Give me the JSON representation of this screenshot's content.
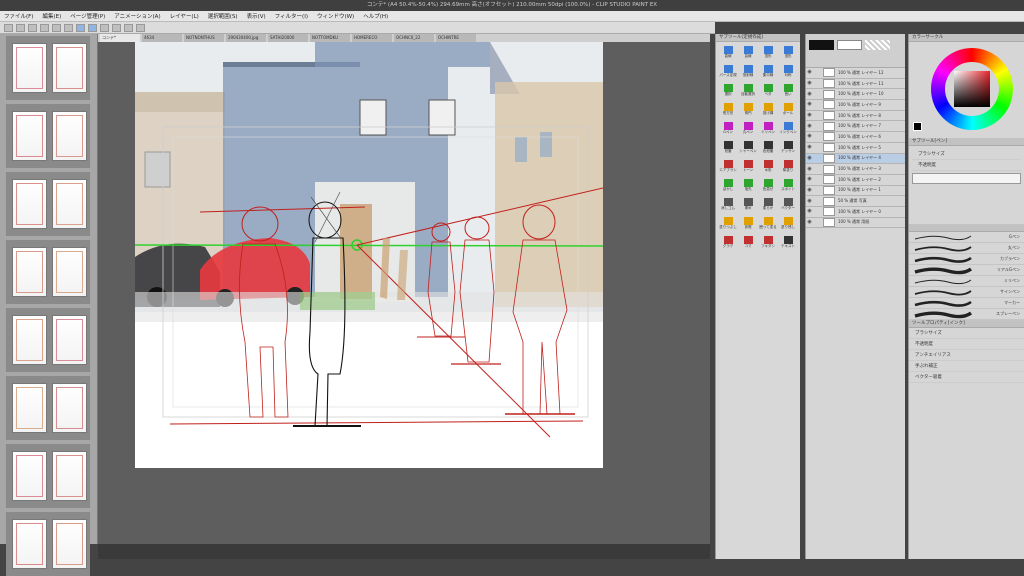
{
  "app": {
    "title": "コンテ* (A4 50.4%-50.4%) 294.69mm 高さ(オフセット) 210.00mm 50dpi (100.0%) - CLIP STUDIO PAINT EX"
  },
  "menu": [
    "ファイル(F)",
    "編集(E)",
    "ページ管理(P)",
    "アニメーション(A)",
    "レイヤー(L)",
    "選択範囲(S)",
    "表示(V)",
    "フィルター(I)",
    "ウィンドウ(W)",
    "ヘルプ(H)"
  ],
  "canvas_tabs": [
    "コンテ*",
    "4634",
    "NOTNONTHUS",
    "290430400.jpg",
    "SATHI20000",
    "NOTTOMDKU",
    "HOMERECO",
    "OCHNC0_22",
    "OCHINTRE"
  ],
  "tool_property_header": "サブツール[定規作成]",
  "tools": [
    {
      "label": "直線",
      "color": "#3a7bd5"
    },
    {
      "label": "曲線",
      "color": "#3a7bd5"
    },
    {
      "label": "図形",
      "color": "#3a7bd5"
    },
    {
      "label": "図形",
      "color": "#3a7bd5"
    },
    {
      "label": "パース定規",
      "color": "#3a7bd5"
    },
    {
      "label": "放射線",
      "color": "#3a7bd5"
    },
    {
      "label": "集中線",
      "color": "#3a7bd5"
    },
    {
      "label": "対称",
      "color": "#3a7bd5"
    },
    {
      "label": "選択",
      "color": "#2ea52e"
    },
    {
      "label": "自動選択",
      "color": "#2ea52e"
    },
    {
      "label": "ベタ",
      "color": "#2ea52e"
    },
    {
      "label": "囲い",
      "color": "#2ea52e"
    },
    {
      "label": "長方形",
      "color": "#e0a000"
    },
    {
      "label": "楕円",
      "color": "#e0a000"
    },
    {
      "label": "投げ縄",
      "color": "#e0a000"
    },
    {
      "label": "ボール",
      "color": "#e0a000"
    },
    {
      "label": "Gペン",
      "color": "#c020c0"
    },
    {
      "label": "丸ペン",
      "color": "#c020c0"
    },
    {
      "label": "ミリペン",
      "color": "#c020c0"
    },
    {
      "label": "インクペン",
      "color": "#3a7bd5"
    },
    {
      "label": "鉛筆",
      "color": "#333"
    },
    {
      "label": "シャーペン",
      "color": "#333"
    },
    {
      "label": "色鉛筆",
      "color": "#333"
    },
    {
      "label": "デッサン",
      "color": "#333"
    },
    {
      "label": "エアブラシ",
      "color": "#c03030"
    },
    {
      "label": "トーン",
      "color": "#c03030"
    },
    {
      "label": "水彩",
      "color": "#c03030"
    },
    {
      "label": "厚塗り",
      "color": "#c03030"
    },
    {
      "label": "ぼかし",
      "color": "#2ea52e"
    },
    {
      "label": "指先",
      "color": "#2ea52e"
    },
    {
      "label": "色混ぜ",
      "color": "#2ea52e"
    },
    {
      "label": "スポイト",
      "color": "#2ea52e"
    },
    {
      "label": "消しゴム",
      "color": "#555"
    },
    {
      "label": "硬め",
      "color": "#555"
    },
    {
      "label": "柔らか",
      "color": "#555"
    },
    {
      "label": "ベクター",
      "color": "#555"
    },
    {
      "label": "塗りつぶし",
      "color": "#e0a000"
    },
    {
      "label": "参照",
      "color": "#e0a000"
    },
    {
      "label": "囲って塗る",
      "color": "#e0a000"
    },
    {
      "label": "塗り残し",
      "color": "#e0a000"
    },
    {
      "label": "グラデ",
      "color": "#c03030"
    },
    {
      "label": "コマ",
      "color": "#c03030"
    },
    {
      "label": "フキダシ",
      "color": "#c03030"
    },
    {
      "label": "テキスト",
      "color": "#333"
    }
  ],
  "layers": [
    {
      "name": "100 % 通常",
      "sub": "レイヤー 12"
    },
    {
      "name": "100 % 通常",
      "sub": "レイヤー 11"
    },
    {
      "name": "100 % 通常",
      "sub": "レイヤー 10"
    },
    {
      "name": "100 % 通常",
      "sub": "レイヤー 9"
    },
    {
      "name": "100 % 通常",
      "sub": "レイヤー 8"
    },
    {
      "name": "100 % 通常",
      "sub": "レイヤー 7"
    },
    {
      "name": "100 % 通常",
      "sub": "レイヤー 6"
    },
    {
      "name": "100 % 通常",
      "sub": "レイヤー 5"
    },
    {
      "name": "100 % 通常",
      "sub": "レイヤー 4"
    },
    {
      "name": "100 % 通常",
      "sub": "レイヤー 3"
    },
    {
      "name": "100 % 通常",
      "sub": "レイヤー 2"
    },
    {
      "name": "100 % 通常",
      "sub": "レイヤー 1"
    },
    {
      "name": "50 % 通常",
      "sub": "写真"
    },
    {
      "name": "100 % 通常",
      "sub": "レイヤー 0"
    },
    {
      "name": "100 % 通常",
      "sub": "用紙"
    }
  ],
  "color_panel_label": "カラーサークル",
  "subtool_label": "サブツール[ペン]",
  "brushes": [
    {
      "name": "Gペン"
    },
    {
      "name": "丸ペン"
    },
    {
      "name": "カブラペン"
    },
    {
      "name": "リアルGペン"
    },
    {
      "name": "ミリペン"
    },
    {
      "name": "サインペン"
    },
    {
      "name": "マーカー"
    },
    {
      "name": "スプレーペン"
    }
  ],
  "tool_settings_label": "ツールプロパティ[インク]",
  "settings": [
    "ブラシサイズ",
    "不透明度",
    "アンチエイリアス",
    "手ぶれ補正",
    "ベクター吸着"
  ]
}
